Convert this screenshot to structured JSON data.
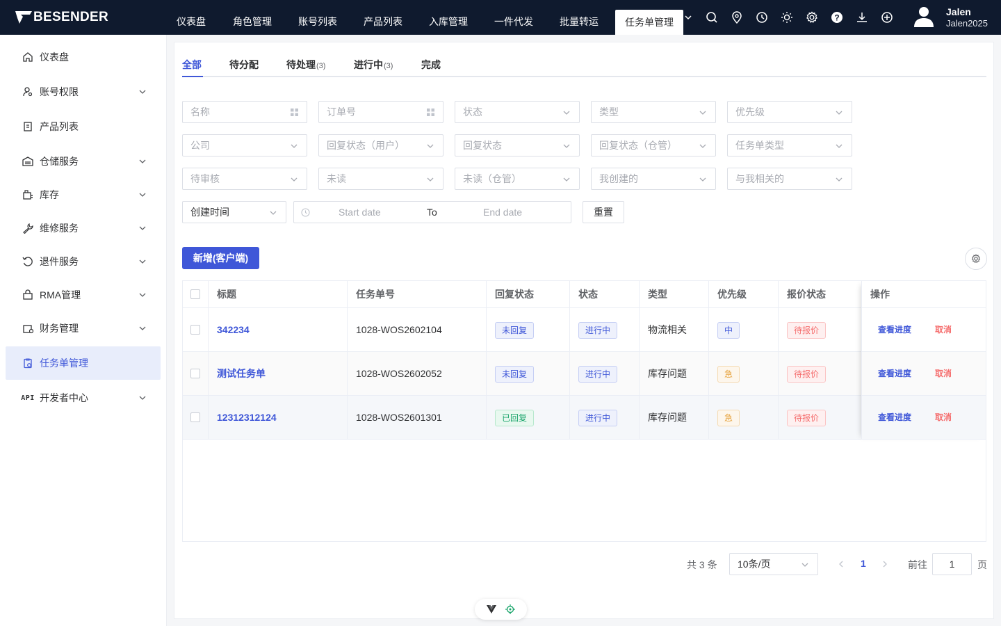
{
  "app": {
    "brand": "BESENDER"
  },
  "topnav": {
    "items": [
      "仪表盘",
      "角色管理",
      "账号列表",
      "产品列表",
      "入库管理",
      "一件代发",
      "批量转运",
      "任务单管理"
    ],
    "active": "任务单管理"
  },
  "user": {
    "name": "Jalen",
    "id": "Jalen2025"
  },
  "sidebar": {
    "items": [
      {
        "label": "仪表盘",
        "icon": "home-icon"
      },
      {
        "label": "账号权限",
        "icon": "user-key-icon"
      },
      {
        "label": "产品列表",
        "icon": "product-icon"
      },
      {
        "label": "仓储服务",
        "icon": "warehouse-icon"
      },
      {
        "label": "库存",
        "icon": "inventory-icon"
      },
      {
        "label": "维修服务",
        "icon": "wrench-icon"
      },
      {
        "label": "退件服务",
        "icon": "return-icon"
      },
      {
        "label": "RMA管理",
        "icon": "rma-icon"
      },
      {
        "label": "财务管理",
        "icon": "finance-icon"
      },
      {
        "label": "任务单管理",
        "icon": "task-icon"
      },
      {
        "label": "开发者中心",
        "icon": "api-icon",
        "icon_text": "API"
      }
    ],
    "active": "任务单管理"
  },
  "tabs": [
    {
      "label": "全部",
      "count": ""
    },
    {
      "label": "待分配",
      "count": ""
    },
    {
      "label": "待处理",
      "count": "(3)"
    },
    {
      "label": "进行中",
      "count": "(3)"
    },
    {
      "label": "完成",
      "count": ""
    }
  ],
  "filters": {
    "row1": [
      "名称",
      "订单号",
      "状态",
      "类型",
      "优先级"
    ],
    "row2": [
      "公司",
      "回复状态（用户）",
      "回复状态",
      "回复状态（仓管）",
      "任务单类型"
    ],
    "row3": [
      "待审核",
      "未读",
      "未读（仓管）",
      "我创建的",
      "与我相关的"
    ],
    "time_select": "创建时间",
    "start_placeholder": "Start date",
    "range_sep": "To",
    "end_placeholder": "End date",
    "reset": "重置"
  },
  "add_button": "新增(客户端)",
  "table": {
    "headers": [
      "标题",
      "任务单号",
      "回复状态",
      "状态",
      "类型",
      "优先级",
      "报价状态",
      "操作"
    ],
    "rows": [
      {
        "title": "342234",
        "no": "1028-WOS2602104",
        "reply": "未回复",
        "status": "进行中",
        "type": "物流相关",
        "priority": "中",
        "quote": "待报价",
        "op_view": "查看进度",
        "op_cancel": "取消"
      },
      {
        "title": "测试任务单",
        "no": "1028-WOS2602052",
        "reply": "未回复",
        "status": "进行中",
        "type": "库存问题",
        "priority": "急",
        "quote": "待报价",
        "op_view": "查看进度",
        "op_cancel": "取消"
      },
      {
        "title": "12312312124",
        "no": "1028-WOS2601301",
        "reply": "已回复",
        "status": "进行中",
        "type": "库存问题",
        "priority": "急",
        "quote": "待报价",
        "op_view": "查看进度",
        "op_cancel": "取消"
      }
    ]
  },
  "pagination": {
    "total": "共 3 条",
    "page_size": "10条/页",
    "current": "1",
    "goto_label": "前往",
    "goto_value": "1",
    "unit": "页"
  },
  "colors": {
    "primary": "#3f57d8",
    "topbar": "#0f1a2e",
    "danger": "#f56c6c",
    "warning": "#e6a23c",
    "success": "#1aa56b"
  }
}
